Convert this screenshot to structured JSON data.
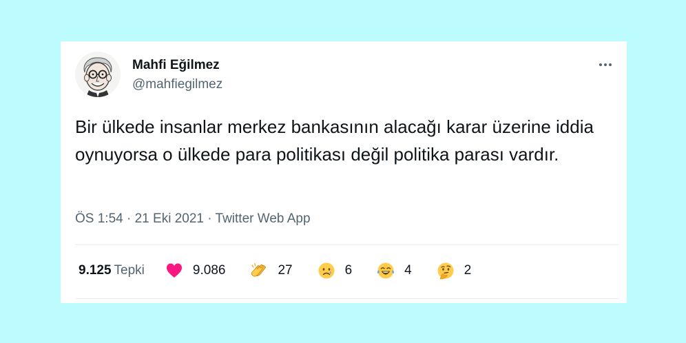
{
  "user": {
    "display_name": "Mahfi Eğilmez",
    "handle": "@mahfiegilmez"
  },
  "tweet": {
    "text": "Bir ülkede insanlar merkez bankasının alacağı karar üzerine iddia oynuyorsa o ülkede para politikası değil politika parası vardır.",
    "time": "ÖS 1:54",
    "date": "21 Eki 2021",
    "source": "Twitter Web App"
  },
  "reactions": {
    "total": "9.125",
    "total_label": "Tepki",
    "items": [
      {
        "icon": "heart-icon",
        "count": "9.086"
      },
      {
        "icon": "clapping-hands-icon",
        "count": "27"
      },
      {
        "icon": "crying-face-icon",
        "count": "6"
      },
      {
        "icon": "tears-of-joy-icon",
        "count": "4"
      },
      {
        "icon": "thinking-face-icon",
        "count": "2"
      }
    ]
  },
  "colors": {
    "background": "#bdfcfe",
    "heart": "#f91880",
    "secondary_text": "#536471"
  }
}
